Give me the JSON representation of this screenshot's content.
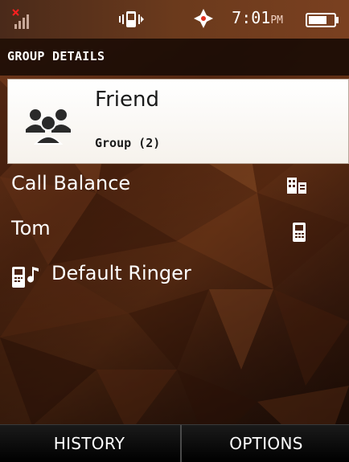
{
  "status_bar": {
    "time": "7:01",
    "ampm": "PM",
    "icons": [
      "no-signal-icon",
      "vibrate-icon",
      "gps-icon",
      "battery-icon"
    ]
  },
  "header": {
    "title": "GROUP DETAILS"
  },
  "group": {
    "name": "Friend",
    "subtitle": "Group (2)",
    "icon": "group-people-icon"
  },
  "list": {
    "items": [
      {
        "label": "Call Balance",
        "icon": "business-icon"
      },
      {
        "label": "Tom",
        "icon": "mobile-phone-icon"
      }
    ],
    "ringer": {
      "label": "Default Ringer",
      "icon": "phone-ringer-icon"
    }
  },
  "softkeys": {
    "left": "HISTORY",
    "right": "OPTIONS"
  },
  "colors": {
    "background": "#5a2a12",
    "header_bg": "#140804",
    "card_bg": "#ffffff",
    "softkey_bg": "#000000",
    "text_light": "#ffffff"
  }
}
